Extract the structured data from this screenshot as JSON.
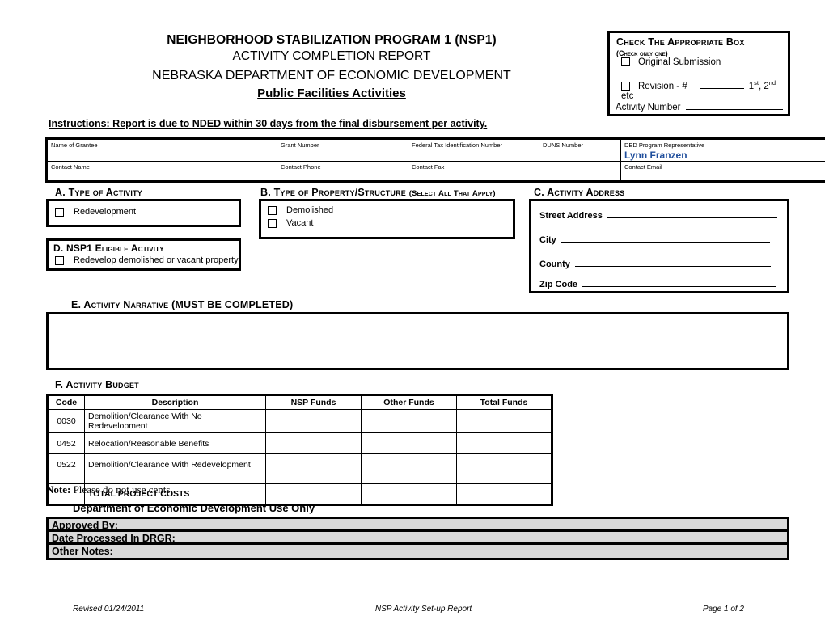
{
  "header": {
    "title_line1": "NEIGHBORHOOD STABILIZATION PROGRAM 1 (NSP1)",
    "title_line2": "ACTIVITY COMPLETION REPORT",
    "title_line3": "NEBRASKA DEPARTMENT OF ECONOMIC DEVELOPMENT",
    "title_line4": "Public Facilities Activities"
  },
  "check_box_panel": {
    "title": "Check The Appropriate Box",
    "subtitle": "(Check only one)",
    "option_original": "Original Submission",
    "option_revision": "Revision - #",
    "revision_suffix_1": "1",
    "revision_suffix_1_sup": "st",
    "revision_suffix_2": ", 2",
    "revision_suffix_2_sup": "nd",
    "revision_suffix_3": " etc",
    "activity_number_label": "Activity Number"
  },
  "instructions": {
    "prefix": "Instructions:  Report is due to NDED within ",
    "days": "30",
    "suffix": " days from the final disbursement per activity."
  },
  "grantee": {
    "row1": [
      {
        "label": "Name of Grantee",
        "value": ""
      },
      {
        "label": "Grant Number",
        "value": ""
      },
      {
        "label": "Federal Tax Identification Number",
        "value": ""
      },
      {
        "label": "DUNS Number",
        "value": ""
      },
      {
        "label": "DED Program Representative",
        "value": "Lynn Franzen"
      }
    ],
    "row2": [
      {
        "label": "Contact Name",
        "value": ""
      },
      {
        "label": "Contact Phone",
        "value": ""
      },
      {
        "label": "Contact Fax",
        "value": ""
      },
      {
        "label": "Contact Email",
        "value": ""
      }
    ]
  },
  "section_a": {
    "heading": "A. Type of Activity",
    "options": [
      "Redevelopment"
    ]
  },
  "section_b": {
    "heading": "B. Type of Property/Structure ",
    "heading_note": "(Select All That Apply)",
    "options": [
      "Demolished",
      "Vacant"
    ]
  },
  "section_c": {
    "heading": "C. Activity Address",
    "fields": [
      "Street Address",
      "City",
      "County",
      "Zip Code"
    ]
  },
  "section_d": {
    "heading_prefix": "D. ",
    "heading_plain": "NSP1 ",
    "heading_sc": "Eligible Activity",
    "options": [
      "Redevelop demolished or vacant property"
    ]
  },
  "section_e": {
    "heading_sc": "E. Activity Narrative ",
    "heading_plain": "(MUST BE COMPLETED)",
    "value": ""
  },
  "section_f": {
    "heading": "F.  Activity Budget",
    "columns": [
      "Code",
      "Description",
      "NSP Funds",
      "Other Funds",
      "Total Funds"
    ],
    "rows": [
      {
        "code": "0030",
        "desc_pre": "Demolition/Clearance With ",
        "desc_underline": "No",
        "desc_post": " Redevelopment",
        "nsp": "",
        "other": "",
        "total": ""
      },
      {
        "code": "0452",
        "desc_pre": "Relocation/Reasonable Benefits",
        "desc_underline": "",
        "desc_post": "",
        "nsp": "",
        "other": "",
        "total": ""
      },
      {
        "code": "0522",
        "desc_pre": "Demolition/Clearance With Redevelopment",
        "desc_underline": "",
        "desc_post": "",
        "nsp": "",
        "other": "",
        "total": ""
      },
      {
        "code": "",
        "desc_pre": "",
        "desc_underline": "",
        "desc_post": "",
        "nsp": "",
        "other": "",
        "total": ""
      }
    ],
    "total_row": {
      "code": "",
      "label": "TOTAL PROJECT COSTS",
      "nsp": "",
      "other": "",
      "total": ""
    }
  },
  "note": {
    "bold": "Note:",
    "text": "  Please do not use cents."
  },
  "ded_use_only": {
    "heading": "Department of Economic Development Use Only",
    "rows": [
      "Approved By:",
      "Date Processed In DRGR:",
      "Other Notes:"
    ]
  },
  "footer": {
    "left": "Revised 01/24/2011",
    "center": "NSP Activity Set-up Report",
    "right": "Page 1 of 2"
  },
  "colors": {
    "rep_name": "#1f4e9c",
    "shaded_row": "#d9d9d9",
    "border": "#000000"
  }
}
